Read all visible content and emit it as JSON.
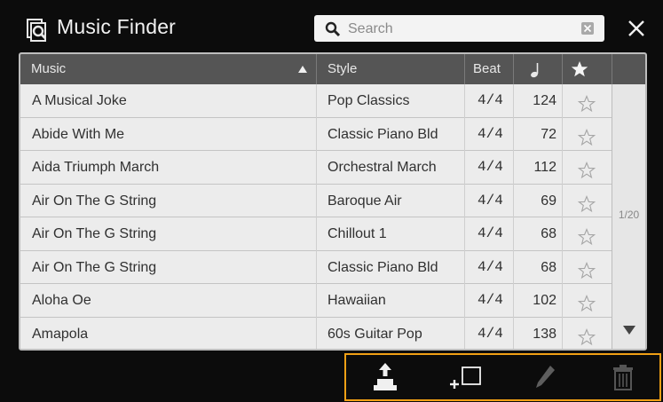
{
  "app": {
    "title": "Music Finder"
  },
  "search": {
    "placeholder": "Search",
    "value": ""
  },
  "table": {
    "headers": {
      "music": "Music",
      "style": "Style",
      "beat": "Beat",
      "tempo_icon": "quarter-note-icon",
      "favorite_icon": "star-filled-icon",
      "sort": "ascending"
    },
    "rows": [
      {
        "music": "A Musical Joke",
        "style": "Pop Classics",
        "beat": "4/4",
        "tempo": "124",
        "favorite": false
      },
      {
        "music": "Abide With Me",
        "style": "Classic Piano Bld",
        "beat": "4/4",
        "tempo": "72",
        "favorite": false
      },
      {
        "music": "Aida Triumph March",
        "style": "Orchestral March",
        "beat": "4/4",
        "tempo": "112",
        "favorite": false
      },
      {
        "music": "Air On The G String",
        "style": "Baroque Air",
        "beat": "4/4",
        "tempo": "69",
        "favorite": false
      },
      {
        "music": "Air On The G String",
        "style": "Chillout 1",
        "beat": "4/4",
        "tempo": "68",
        "favorite": false
      },
      {
        "music": "Air On The G String",
        "style": "Classic Piano Bld",
        "beat": "4/4",
        "tempo": "68",
        "favorite": false
      },
      {
        "music": "Aloha Oe",
        "style": "Hawaiian",
        "beat": "4/4",
        "tempo": "102",
        "favorite": false
      },
      {
        "music": "Amapola",
        "style": "60s Guitar Pop",
        "beat": "4/4",
        "tempo": "138",
        "favorite": false
      }
    ]
  },
  "pagination": {
    "label": "1/20"
  },
  "toolbar": {
    "buttons": [
      "load-icon",
      "new-record-icon",
      "edit-icon",
      "delete-icon"
    ]
  },
  "colors": {
    "header_bg": "#555555",
    "row_bg": "#ececec",
    "accent": "#f0a015",
    "background": "#0c0c0c"
  }
}
